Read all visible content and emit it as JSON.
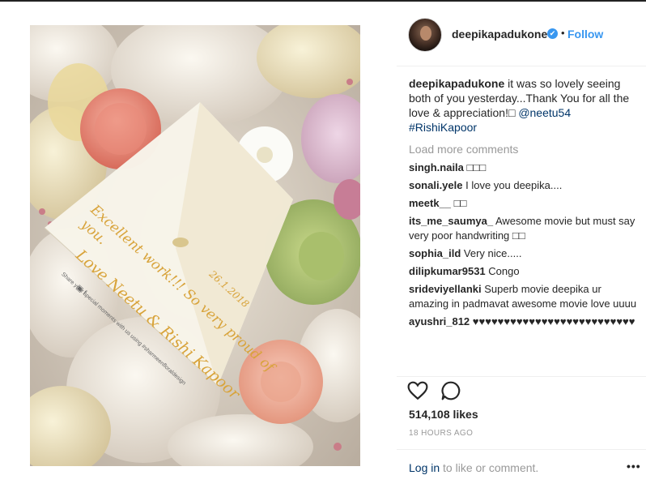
{
  "post": {
    "username": "deepikapadukone",
    "verified_glyph": "✔",
    "separator": "•",
    "follow_label": "Follow",
    "caption_user": "deepikapadukone",
    "caption_text": " it was so lovely seeing both of you yesterday...Thank You for all the love & appreciation!□ ",
    "caption_mention": "@neetu54",
    "caption_hashtag": "#RishiKapoor",
    "load_more_label": "Load more comments",
    "comments": [
      {
        "user": "singh.naila",
        "text": " □□□"
      },
      {
        "user": "sonali.yele",
        "text": " I love you deepika...."
      },
      {
        "user": "meetk__",
        "text": " □□"
      },
      {
        "user": "its_me_saumya_",
        "text": " Awesome movie but must say very poor handwriting □□"
      },
      {
        "user": "sophia_ild",
        "text": " Very nice....."
      },
      {
        "user": "dilipkumar9531",
        "text": " Congo"
      },
      {
        "user": "srideviyellanki",
        "text": " Superb movie deepika ur amazing in padmavat awesome movie love uuuu"
      },
      {
        "user": "ayushri_812",
        "text": " ♥♥♥♥♥♥♥♥♥♥♥♥♥♥♥♥♥♥♥♥♥♥♥♥♥♥"
      }
    ],
    "likes": "514,108 likes",
    "timestamp": "18 HOURS AGO",
    "login_link": "Log in",
    "login_rest": " to like or comment.",
    "more_label": "•••",
    "icons": {
      "like": "heart-icon",
      "comment": "comment-bubble-icon",
      "more": "more-options-icon"
    }
  },
  "photo_card": {
    "line1": "Excellent work!!! So very proud of",
    "line2": "you.",
    "date": "26.1.2018",
    "line3": "Love Neetu & Rishi Kapoor",
    "small1": "Share your special moments with us using #sharmeenfloraldesign",
    "small2": "▣ f"
  },
  "colors": {
    "accent": "#3897f0",
    "link": "#003569",
    "muted": "#999999",
    "text": "#262626"
  }
}
